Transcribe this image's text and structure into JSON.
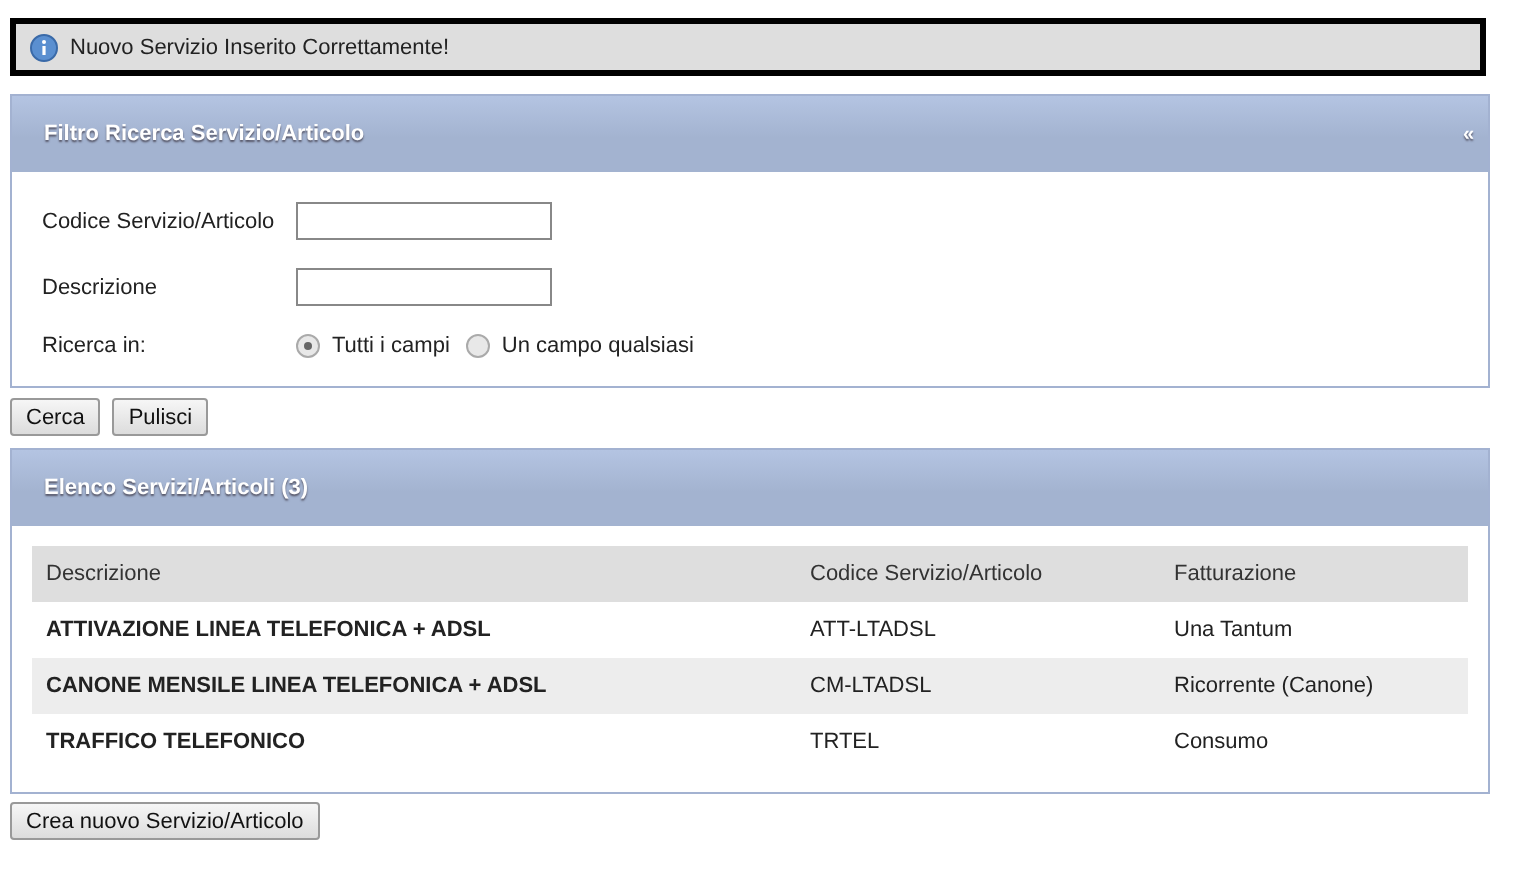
{
  "message": {
    "text": "Nuovo Servizio Inserito Correttamente!"
  },
  "filter_panel": {
    "title": "Filtro Ricerca Servizio/Articolo",
    "collapse": "«",
    "fields": [
      {
        "label": "Codice Servizio/Articolo"
      },
      {
        "label": "Descrizione"
      }
    ],
    "search_in": {
      "label": "Ricerca in:",
      "options": [
        {
          "label": "Tutti i campi",
          "selected": true
        },
        {
          "label": "Un campo qualsiasi",
          "selected": false
        }
      ]
    }
  },
  "filter_buttons": [
    "Cerca",
    "Pulisci"
  ],
  "list_panel": {
    "title": "Elenco Servizi/Articoli (3)",
    "table": {
      "columns": [
        "Descrizione",
        "Codice Servizio/Articolo",
        "Fatturazione"
      ],
      "rows": [
        [
          "ATTIVAZIONE LINEA TELEFONICA + ADSL",
          "ATT-LTADSL",
          "Una Tantum"
        ],
        [
          "CANONE MENSILE LINEA TELEFONICA + ADSL",
          "CM-LTADSL",
          "Ricorrente (Canone)"
        ],
        [
          "TRAFFICO TELEFONICO",
          "TRTEL",
          "Consumo"
        ]
      ]
    }
  },
  "create_button": "Crea nuovo Servizio/Articolo"
}
